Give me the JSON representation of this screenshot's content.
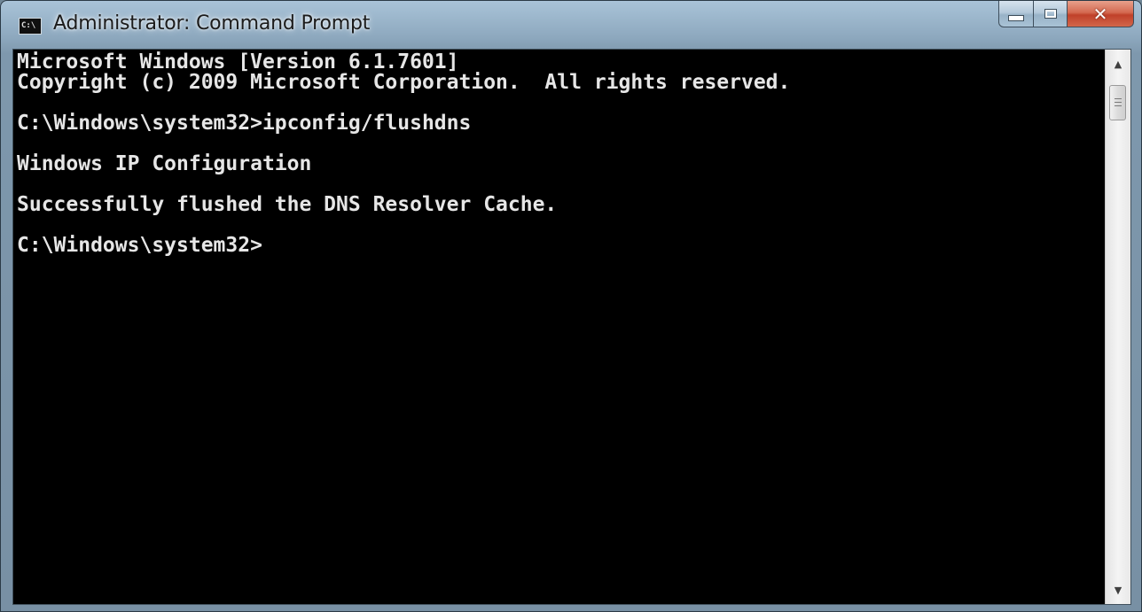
{
  "window": {
    "title": "Administrator: Command Prompt",
    "icon_label": "C:\\",
    "controls": {
      "minimize": "minimize-icon",
      "maximize": "maximize-icon",
      "close": "close-icon",
      "close_glyph": "✕"
    },
    "colors": {
      "console_background": "#000000",
      "console_text": "#e6e6e6",
      "close_button": "#c94a31",
      "frame": "#8ea9bf"
    }
  },
  "console": {
    "lines": [
      "Microsoft Windows [Version 6.1.7601]",
      "Copyright (c) 2009 Microsoft Corporation.  All rights reserved.",
      "",
      "C:\\Windows\\system32>ipconfig/flushdns",
      "",
      "Windows IP Configuration",
      "",
      "Successfully flushed the DNS Resolver Cache.",
      "",
      "C:\\Windows\\system32>"
    ]
  },
  "scrollbar": {
    "up_arrow": "▲",
    "down_arrow": "▼",
    "position_fraction": 0
  }
}
